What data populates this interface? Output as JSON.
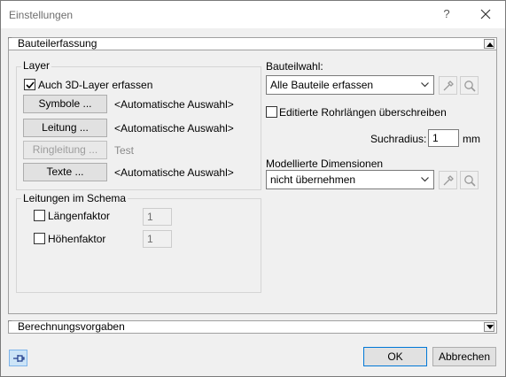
{
  "window": {
    "title": "Einstellungen",
    "help_label": "?"
  },
  "sections": {
    "erfassung": "Bauteilerfassung",
    "berechnung": "Berechnungsvorgaben"
  },
  "layer": {
    "legend": "Layer",
    "include_3d": {
      "label": "Auch 3D-Layer erfassen",
      "checked": true
    },
    "rows": [
      {
        "button": "Symbole ...",
        "value": "<Automatische Auswahl>",
        "enabled": true
      },
      {
        "button": "Leitung ...",
        "value": "<Automatische Auswahl>",
        "enabled": true
      },
      {
        "button": "Ringleitung ...",
        "value": "Test",
        "enabled": false
      },
      {
        "button": "Texte ...",
        "value": "<Automatische Auswahl>",
        "enabled": true
      }
    ]
  },
  "schema": {
    "legend": "Leitungen im Schema",
    "laengenfaktor": {
      "label": "Längenfaktor",
      "checked": false,
      "value": "1"
    },
    "hoehenfaktor": {
      "label": "Höhenfaktor",
      "checked": false,
      "value": "1"
    }
  },
  "bauteilwahl": {
    "label": "Bauteilwahl:",
    "selected": "Alle Bauteile erfassen"
  },
  "rohrlaengen": {
    "label": "Editierte Rohrlängen überschreiben",
    "checked": false
  },
  "suchradius": {
    "label": "Suchradius:",
    "value": "1",
    "unit": "mm"
  },
  "dimensionen": {
    "label": "Modellierte Dimensionen",
    "selected": "nicht übernehmen"
  },
  "footer": {
    "ok_label": "OK",
    "cancel_label": "Abbrechen"
  },
  "icons": {
    "close": "close-icon",
    "pin": "pin-icon",
    "pick": "eyedropper-icon",
    "search": "magnifier-icon",
    "collapse": "triangle-up-icon",
    "expand": "triangle-down-icon"
  },
  "colors": {
    "accent": "#0078d7",
    "pin_bg": "#cce4f7"
  }
}
